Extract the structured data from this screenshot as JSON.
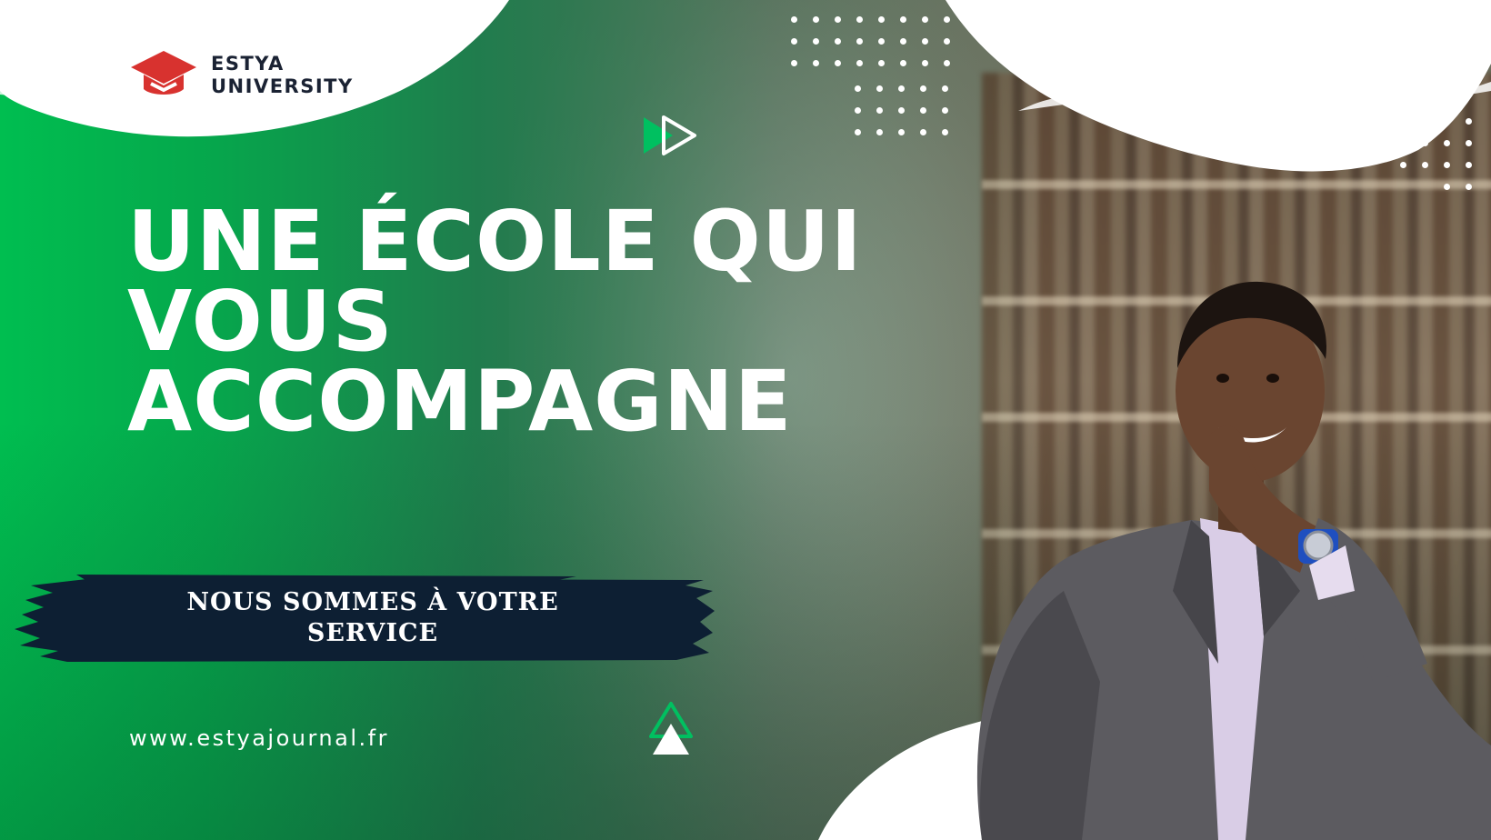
{
  "brand": {
    "name_line1": "ESTYA",
    "name_line2": "UNIVERSITY",
    "logo_color": "#d8322f",
    "text_color": "#1a2233"
  },
  "headline": {
    "line1": "UNE ÉCOLE QUI",
    "line2": "VOUS",
    "line3": "ACCOMPAGNE"
  },
  "tagline": {
    "line1": "NOUS SOMMES À VOTRE",
    "line2": "SERVICE",
    "banner_color": "#0d1f33"
  },
  "footer": {
    "url": "www.estyajournal.fr"
  },
  "colors": {
    "accent_green": "#00c060",
    "white": "#ffffff"
  },
  "icons": [
    "graduation-cap-icon",
    "fast-forward-icon",
    "triangle-up-icon"
  ]
}
